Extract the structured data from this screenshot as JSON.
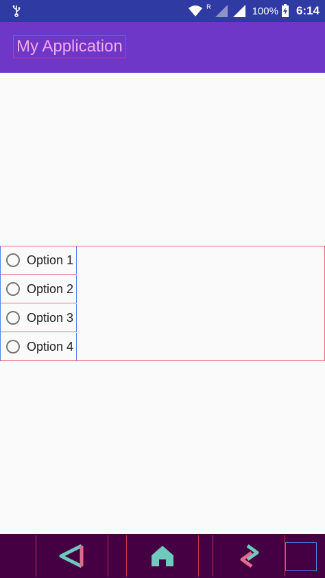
{
  "status_bar": {
    "battery_percent": "100%",
    "time": "6:14",
    "network_type": "R",
    "icons": [
      "usb-icon",
      "wifi-icon",
      "signal-icon",
      "signal-icon",
      "battery-icon"
    ]
  },
  "app_bar": {
    "title": "My Application",
    "title_color": "#f4a7ec",
    "background": "#6e37c8"
  },
  "radio_group": {
    "options": [
      {
        "label": "Option 1",
        "checked": false
      },
      {
        "label": "Option 2",
        "checked": false
      },
      {
        "label": "Option 3",
        "checked": false
      },
      {
        "label": "Option 4",
        "checked": false
      }
    ]
  },
  "nav_bar": {
    "buttons": [
      "back",
      "home",
      "recents"
    ],
    "back_color": "#e06b8a",
    "home_color": "#6fc9bd",
    "recents_color": "#6fc9bd"
  }
}
